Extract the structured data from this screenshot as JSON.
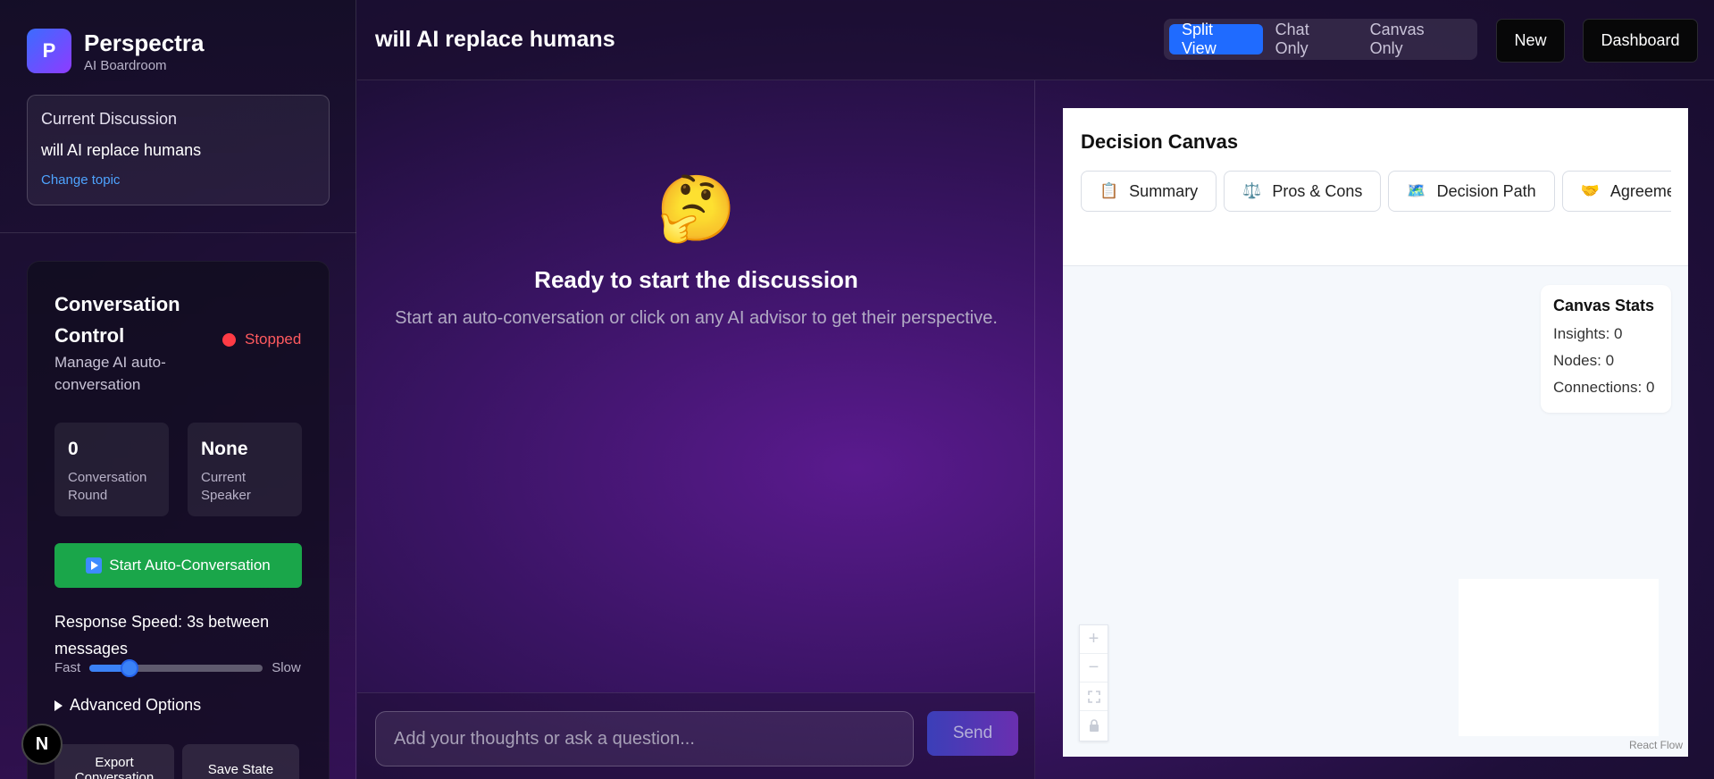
{
  "brand": {
    "logo_letter": "P",
    "name": "Perspectra",
    "subtitle": "AI Boardroom"
  },
  "topic": {
    "label": "Current Discussion",
    "value": "will AI replace humans",
    "change_link": "Change topic"
  },
  "control": {
    "title": "Conversation Control",
    "subtitle": "Manage AI auto-conversation",
    "status": "Stopped",
    "round": {
      "value": "0",
      "label": "Conversation Round"
    },
    "speaker": {
      "value": "None",
      "label": "Current Speaker"
    },
    "start_button": "Start Auto-Conversation",
    "speed_label": "Response Speed: 3s between messages",
    "speed_fast": "Fast",
    "speed_slow": "Slow",
    "speed_fraction": 0.2,
    "advanced_options": "Advanced Options",
    "export_button": "Export Conversation",
    "save_button": "Save State"
  },
  "header": {
    "title": "will AI replace humans",
    "views": [
      "Split View",
      "Chat Only",
      "Canvas Only"
    ],
    "active_view": "Split View",
    "new_button": "New",
    "dashboard_button": "Dashboard"
  },
  "chat": {
    "empty_emoji": "🤔",
    "empty_title": "Ready to start the discussion",
    "empty_subtitle": "Start an auto-conversation or click on any AI advisor to get their perspective.",
    "input_placeholder": "Add your thoughts or ask a question...",
    "send_button": "Send"
  },
  "canvas": {
    "title": "Decision Canvas",
    "tabs": [
      {
        "icon": "📋",
        "label": "Summary"
      },
      {
        "icon": "⚖️",
        "label": "Pros & Cons"
      },
      {
        "icon": "🗺️",
        "label": "Decision Path"
      },
      {
        "icon": "🤝",
        "label": "Agreement"
      }
    ],
    "stats": {
      "title": "Canvas Stats",
      "insights": "Insights: 0",
      "nodes": "Nodes: 0",
      "connections": "Connections: 0"
    },
    "attribution": "React Flow"
  },
  "badge": {
    "letter": "N"
  },
  "colors": {
    "accent": "#1f6bff",
    "start_green": "#1aa64a",
    "stopped_red": "#ff3b45",
    "link_blue": "#4ea4ff"
  }
}
